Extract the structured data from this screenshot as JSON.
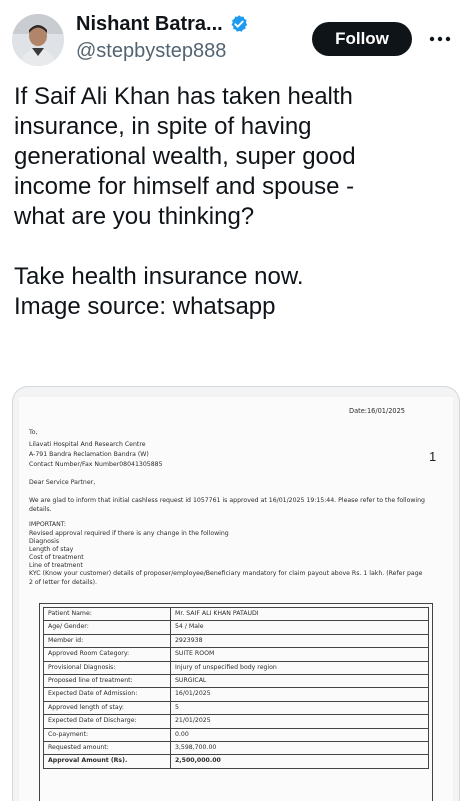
{
  "author": {
    "display_name": "Nishant Batra...",
    "handle": "@stepbystep888",
    "verified_icon": "verified-badge-icon",
    "verified_color": "#1d9bf0"
  },
  "follow_label": "Follow",
  "more_icon": "more-options-icon",
  "tweet": {
    "line1": "If Saif Ali Khan has taken health",
    "line2": "insurance, in spite of having",
    "line3": "generational wealth, super good",
    "line4": "income for himself and spouse -",
    "line5": "what are you thinking?",
    "line6": "Take health insurance now.",
    "line7": "Image source: whatsapp"
  },
  "document": {
    "date": "Date:16/01/2025",
    "to": "To,",
    "hospital": "Lilavati Hospital And Research Centre",
    "address": "A-791 Bandra Reclamation  Bandra (W)",
    "contact": "Contact Number/Fax Number08041305885",
    "salutation": "Dear Service Partner,",
    "intro1": "We are glad to inform that initial cashless request id 1057761 is approved at 16/01/2025 19:15:44. Please refer to the following",
    "intro2": "details.",
    "important": "IMPORTANT:",
    "revised": "Revised approval required if there is any change in the following",
    "b1": "Diagnosis",
    "b2": "Length of stay",
    "b3": "Cost of treatment",
    "b4": "Line of treatment",
    "kyc1": "KYC (Know your customer) details of proposer/employee/Beneficiary mandatory for claim payout above Rs. 1 lakh. (Refer page",
    "kyc2": "2 of letter for details).",
    "page_number": "1",
    "table": [
      {
        "k": "Patient Name:",
        "v": "Mr. SAIF ALI KHAN PATAUDI"
      },
      {
        "k": "Age/ Gender:",
        "v": "54 / Male"
      },
      {
        "k": "Member id:",
        "v": "2923938"
      },
      {
        "k": "Approved Room Category:",
        "v": "SUITE ROOM"
      },
      {
        "k": "Provisional Diagnosis:",
        "v": "Injury of unspecified body region"
      },
      {
        "k": "Proposed line of treatment:",
        "v": "SURGICAL"
      },
      {
        "k": "Expected Date of Admission:",
        "v": "16/01/2025"
      },
      {
        "k": "Approved length of stay:",
        "v": "5"
      },
      {
        "k": "Expected Date of Discharge:",
        "v": "21/01/2025"
      },
      {
        "k": "Co-payment:",
        "v": "0.00"
      },
      {
        "k": "Requested amount:",
        "v": "3,598,700.00"
      },
      {
        "k": "Approval Amount (Rs).",
        "v": "2,500,000.00"
      }
    ]
  }
}
